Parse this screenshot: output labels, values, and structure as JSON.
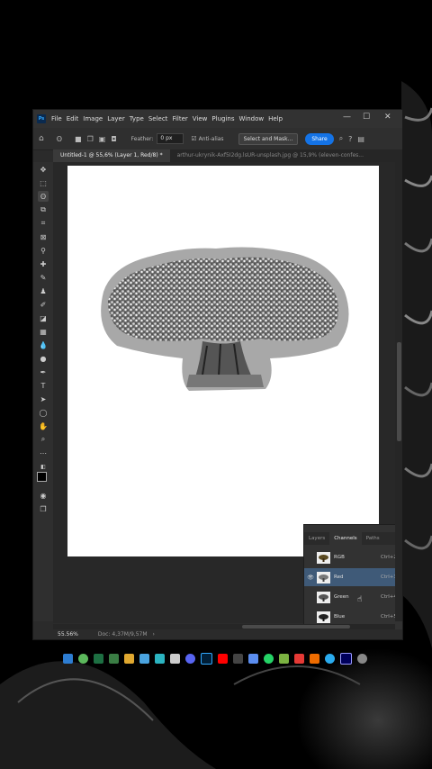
{
  "menubar": {
    "app_icon": "Ps",
    "items": [
      "File",
      "Edit",
      "Image",
      "Layer",
      "Type",
      "Select",
      "Filter",
      "View",
      "Plugins",
      "Window",
      "Help"
    ],
    "controls": [
      "—",
      "☐",
      "✕"
    ]
  },
  "options": {
    "feather_label": "Feather:",
    "feather_value": "0 px",
    "antialias_label": "Anti-alias",
    "select_mask_label": "Select and Mask...",
    "share_label": "Share"
  },
  "tabs": {
    "active": "Untitled-1 @ 55,6% (Layer 1, Red/8) *",
    "inactive": "arthur-ukrynik-Axf5I2dg.lsUR-unsplash.jpg @ 15,9% (eleven-confes..."
  },
  "status": {
    "zoom": "55.56%",
    "doc": "Doc: 4,37M/9,57M"
  },
  "channels_panel": {
    "tabs": [
      "Layers",
      "Channels",
      "Paths"
    ],
    "active_tab": "Channels",
    "rows": [
      {
        "name": "RGB",
        "shortcut": "Ctrl+2"
      },
      {
        "name": "Red",
        "shortcut": "Ctrl+3"
      },
      {
        "name": "Green",
        "shortcut": "Ctrl+4"
      },
      {
        "name": "Blue",
        "shortcut": "Ctrl+5"
      }
    ]
  },
  "colors": {
    "accent": "#1473e6",
    "selected_row": "#3f5a78"
  },
  "icons": [
    "move-icon",
    "marquee-icon",
    "lasso-icon",
    "crop-icon",
    "brush-icon",
    "eraser-icon",
    "text-icon",
    "zoom-icon",
    "eye-icon"
  ]
}
